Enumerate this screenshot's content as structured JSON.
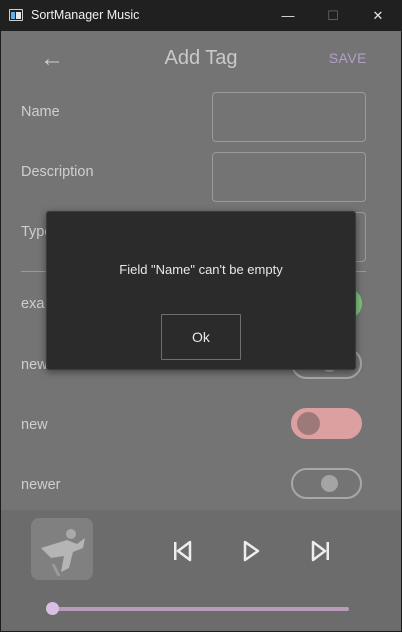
{
  "window": {
    "title": "SortManager Music",
    "minimize_glyph": "—",
    "maximize_glyph": "☐",
    "close_glyph": "✕"
  },
  "header": {
    "back_glyph": "←",
    "title": "Add Tag",
    "save_label": "SAVE"
  },
  "form": {
    "name_label": "Name",
    "name_value": "",
    "description_label": "Description",
    "description_value": "",
    "type_label": "Type"
  },
  "tags": [
    {
      "label": "exa",
      "state": "on"
    },
    {
      "label": "new",
      "state": "off"
    },
    {
      "label": "new",
      "state": "pink"
    },
    {
      "label": "newer",
      "state": "off"
    }
  ],
  "player": {
    "album_art_icon": "album-art-image",
    "progress": 0
  },
  "dialog": {
    "message": "Field \"Name\" can't be empty",
    "ok_label": "Ok"
  },
  "colors": {
    "accent_save": "#b59ec9",
    "toggle_on": "#7fc27f",
    "toggle_pink": "#dca0a0",
    "progress": "#d9bfe3"
  }
}
